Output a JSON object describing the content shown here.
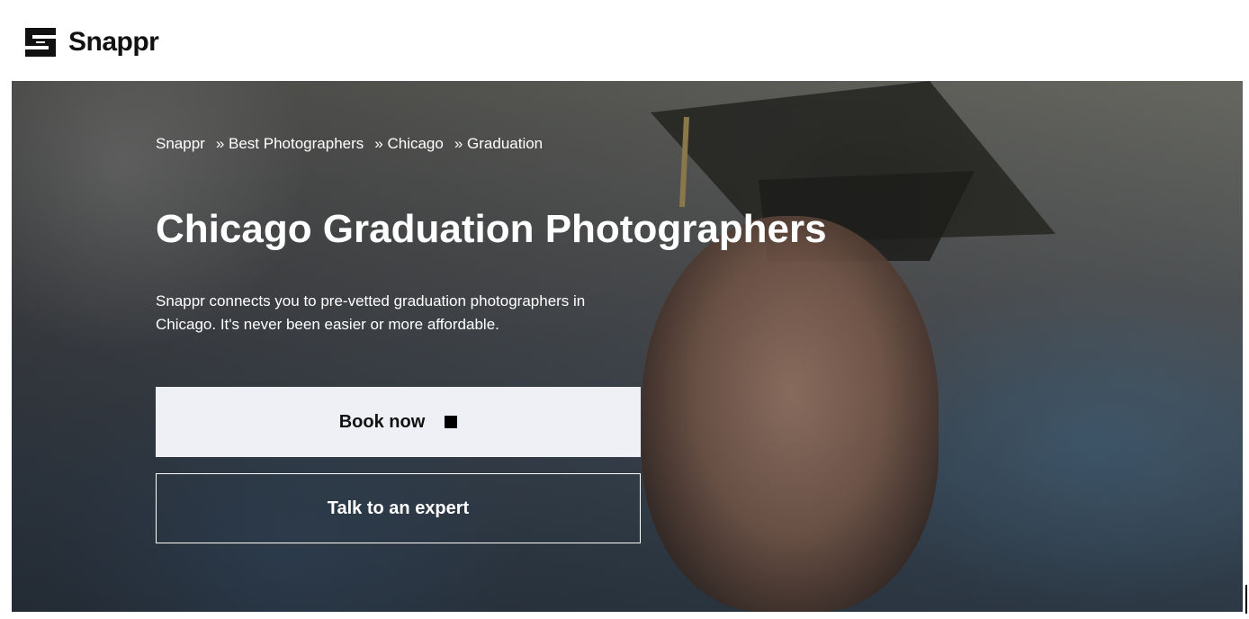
{
  "brand": {
    "name": "Snappr"
  },
  "breadcrumb": [
    {
      "label": "Snappr"
    },
    {
      "label": "» Best Photographers"
    },
    {
      "label": "» Chicago"
    },
    {
      "label": "» Graduation"
    }
  ],
  "hero": {
    "title": "Chicago Graduation Photographers",
    "description": "Snappr connects you to pre-vetted graduation photographers in Chicago. It's never been easier or more affordable.",
    "primary_button": "Book now",
    "secondary_button": "Talk to an expert",
    "image_icon": "graduation-portrait-photo"
  },
  "colors": {
    "primary_button_bg": "#eef0f5",
    "text_on_hero": "#ffffff",
    "brand_dark": "#111111"
  }
}
